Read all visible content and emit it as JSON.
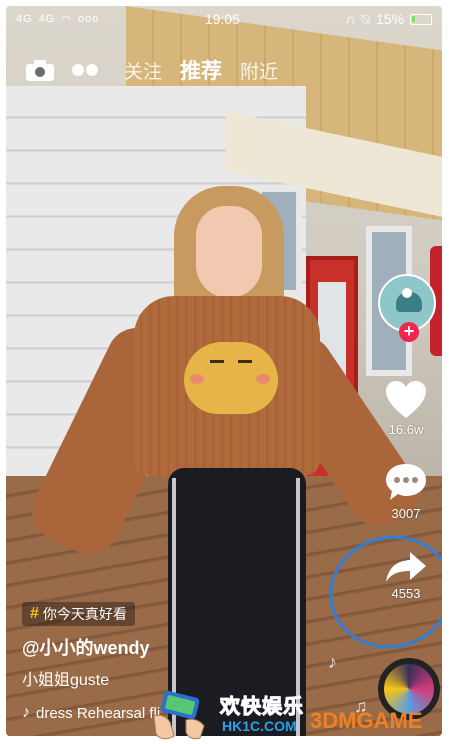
{
  "status_bar": {
    "signal_1": "4G",
    "signal_2": "4G",
    "extra": "ooo",
    "time": "19:05",
    "battery_percent": "15%",
    "battery_level": 0.15
  },
  "top_nav": {
    "tabs": [
      {
        "label": "关注",
        "active": false
      },
      {
        "label": "推荐",
        "active": true
      },
      {
        "label": "附近",
        "active": false
      }
    ]
  },
  "rail": {
    "follow_symbol": "+",
    "like_count": "16.6w",
    "comment_count": "3007",
    "share_count": "4553"
  },
  "caption": {
    "hashtag_symbol": "#",
    "hashtag": "你今天真好看",
    "username": "@小小的wendy",
    "description": "小姐姐guste",
    "music_note": "♪",
    "music": "dress Rehearsal  fli"
  },
  "watermark": {
    "cn_text": "欢快娱乐",
    "url": "HK1C.COM",
    "brand": "3DMGAME"
  },
  "colors": {
    "follow_red": "#f2264c",
    "annotation_blue": "#2f7fd8",
    "hashtag_yellow": "#f5c518"
  }
}
